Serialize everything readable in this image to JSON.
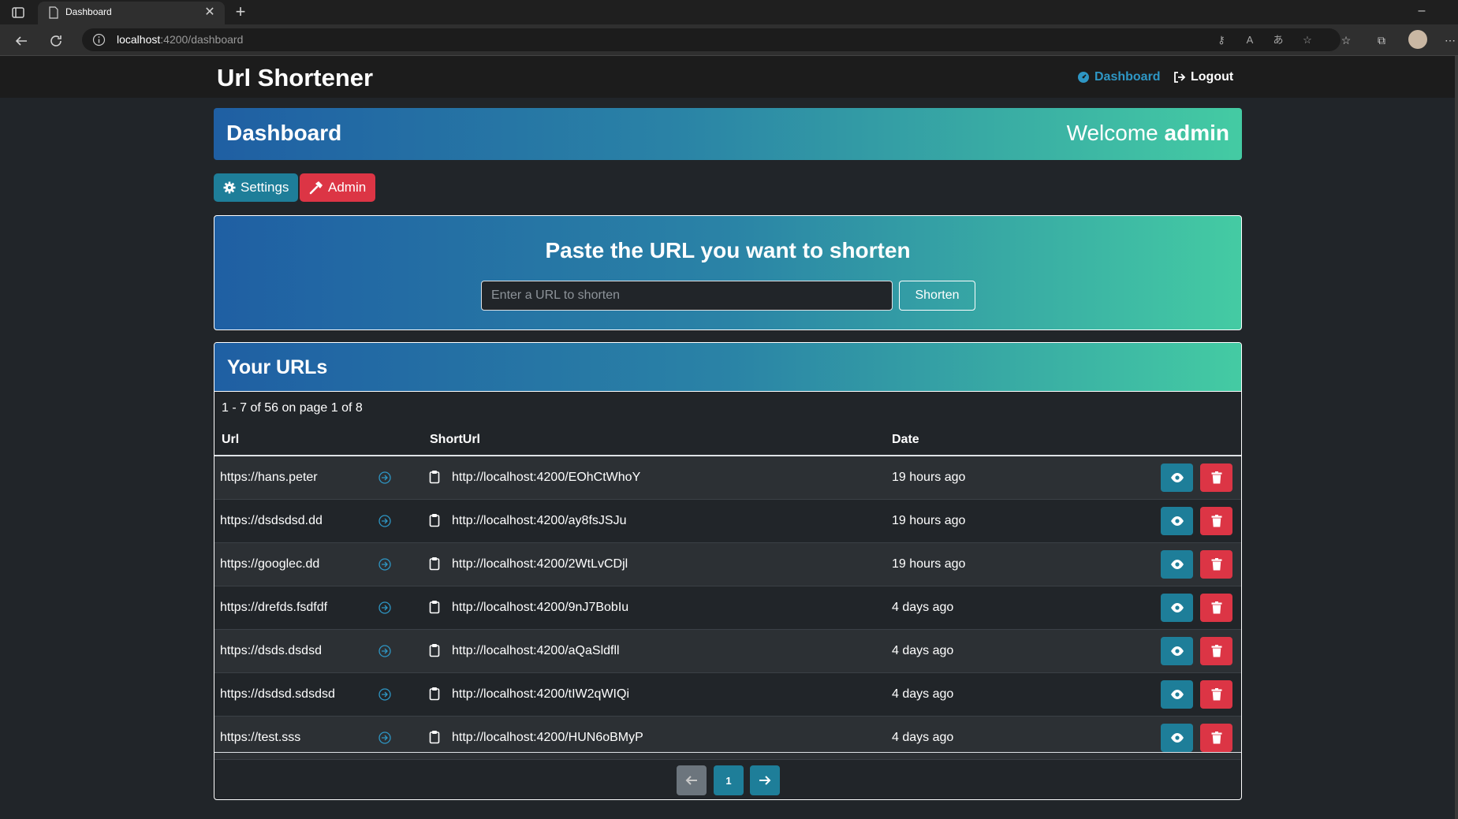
{
  "browser": {
    "tab_title": "Dashboard",
    "address_host": "localhost",
    "address_rest": ":4200/dashboard"
  },
  "header": {
    "brand": "Url Shortener",
    "dashboard_link": "Dashboard",
    "logout_link": "Logout",
    "accent_color": "#2e96c4"
  },
  "banner": {
    "title": "Dashboard",
    "welcome_prefix": "Welcome",
    "username": "admin"
  },
  "actions": {
    "settings_label": "Settings",
    "admin_label": "Admin"
  },
  "shorten": {
    "title": "Paste the URL you want to shorten",
    "placeholder": "Enter a URL to shorten",
    "button_label": "Shorten"
  },
  "urls": {
    "title": "Your URLs",
    "pager_info": "1 - 7 of 56 on page 1 of 8",
    "columns": [
      "Url",
      "ShortUrl",
      "Date"
    ],
    "rows": [
      {
        "url": "https://hans.peter",
        "short": "http://localhost:4200/EOhCtWhoY",
        "date": "19 hours ago"
      },
      {
        "url": "https://dsdsdsd.dd",
        "short": "http://localhost:4200/ay8fsJSJu",
        "date": "19 hours ago"
      },
      {
        "url": "https://googlec.dd",
        "short": "http://localhost:4200/2WtLvCDjl",
        "date": "19 hours ago"
      },
      {
        "url": "https://drefds.fsdfdf",
        "short": "http://localhost:4200/9nJ7BobIu",
        "date": "4 days ago"
      },
      {
        "url": "https://dsds.dsdsd",
        "short": "http://localhost:4200/aQaSldfll",
        "date": "4 days ago"
      },
      {
        "url": "https://dsdsd.sdsdsd",
        "short": "http://localhost:4200/tIW2qWIQi",
        "date": "4 days ago"
      },
      {
        "url": "https://test.sss",
        "short": "http://localhost:4200/HUN6oBMyP",
        "date": "4 days ago"
      }
    ],
    "current_page": "1"
  },
  "colors": {
    "primary": "#1e7e99",
    "danger": "#dc3545",
    "gradient_start": "#1f5fa3",
    "gradient_end": "#44cba3"
  }
}
